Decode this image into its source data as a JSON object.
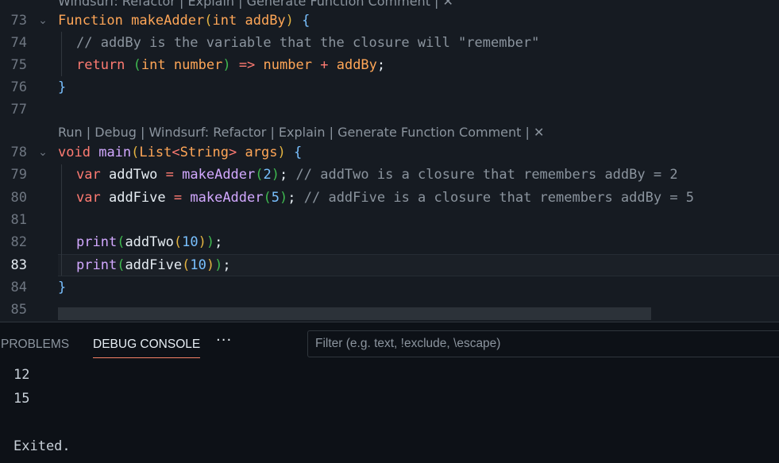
{
  "editor": {
    "codelens_top": {
      "items": [
        "Windsurf: Refactor",
        "Explain",
        "Generate Function Comment"
      ],
      "close": "✕"
    },
    "codelens_main": {
      "items": [
        "Run",
        "Debug",
        "Windsurf: Refactor",
        "Explain",
        "Generate Function Comment"
      ],
      "close": "✕"
    },
    "separator": " | ",
    "lines": [
      {
        "number": "73",
        "tokens": [
          [
            "Function",
            "ty"
          ],
          [
            " ",
            "plain"
          ],
          [
            "makeAdder",
            "id"
          ],
          [
            "(",
            "br3"
          ],
          [
            "int",
            "ty"
          ],
          [
            " ",
            "plain"
          ],
          [
            "addBy",
            "id"
          ],
          [
            ")",
            "br3"
          ],
          [
            " ",
            "plain"
          ],
          [
            "{",
            "br1"
          ]
        ]
      },
      {
        "number": "74",
        "tokens": [
          [
            "// addBy is the variable that the closure will \"remember\"",
            "cm"
          ]
        ]
      },
      {
        "number": "75",
        "tokens": [
          [
            "return",
            "kw"
          ],
          [
            " ",
            "plain"
          ],
          [
            "(",
            "br2"
          ],
          [
            "int",
            "ty"
          ],
          [
            " ",
            "plain"
          ],
          [
            "number",
            "id"
          ],
          [
            ")",
            "br2"
          ],
          [
            " ",
            "plain"
          ],
          [
            "=>",
            "op"
          ],
          [
            " ",
            "plain"
          ],
          [
            "number",
            "id"
          ],
          [
            " ",
            "plain"
          ],
          [
            "+",
            "op"
          ],
          [
            " ",
            "plain"
          ],
          [
            "addBy",
            "id"
          ],
          [
            ";",
            "plain"
          ]
        ]
      },
      {
        "number": "76",
        "tokens": [
          [
            "}",
            "br1"
          ]
        ]
      },
      {
        "number": "77",
        "tokens": []
      },
      {
        "number": "78",
        "tokens": [
          [
            "void",
            "kw"
          ],
          [
            " ",
            "plain"
          ],
          [
            "main",
            "fn"
          ],
          [
            "(",
            "br3"
          ],
          [
            "List",
            "ty"
          ],
          [
            "<",
            "op"
          ],
          [
            "String",
            "ty"
          ],
          [
            ">",
            "op"
          ],
          [
            " ",
            "plain"
          ],
          [
            "args",
            "id"
          ],
          [
            ")",
            "br3"
          ],
          [
            " ",
            "plain"
          ],
          [
            "{",
            "br1"
          ]
        ]
      },
      {
        "number": "79",
        "tokens": [
          [
            "var",
            "kw"
          ],
          [
            " ",
            "plain"
          ],
          [
            "addTwo",
            "plain"
          ],
          [
            " ",
            "plain"
          ],
          [
            "=",
            "op"
          ],
          [
            " ",
            "plain"
          ],
          [
            "makeAdder",
            "fn"
          ],
          [
            "(",
            "br2"
          ],
          [
            "2",
            "num"
          ],
          [
            ")",
            "br2"
          ],
          [
            ";",
            "plain"
          ],
          [
            " ",
            "plain"
          ],
          [
            "// addTwo is a closure that remembers addBy = 2",
            "cm"
          ]
        ]
      },
      {
        "number": "80",
        "tokens": [
          [
            "var",
            "kw"
          ],
          [
            " ",
            "plain"
          ],
          [
            "addFive",
            "plain"
          ],
          [
            " ",
            "plain"
          ],
          [
            "=",
            "op"
          ],
          [
            " ",
            "plain"
          ],
          [
            "makeAdder",
            "fn"
          ],
          [
            "(",
            "br2"
          ],
          [
            "5",
            "num"
          ],
          [
            ")",
            "br2"
          ],
          [
            ";",
            "plain"
          ],
          [
            " ",
            "plain"
          ],
          [
            "// addFive is a closure that remembers addBy = 5",
            "cm"
          ]
        ]
      },
      {
        "number": "81",
        "tokens": []
      },
      {
        "number": "82",
        "tokens": [
          [
            "print",
            "fn"
          ],
          [
            "(",
            "br2"
          ],
          [
            "addTwo",
            "plain"
          ],
          [
            "(",
            "br3"
          ],
          [
            "10",
            "num"
          ],
          [
            ")",
            "br3"
          ],
          [
            ")",
            "br2"
          ],
          [
            ";",
            "plain"
          ]
        ]
      },
      {
        "number": "83",
        "tokens": [
          [
            "print",
            "fn"
          ],
          [
            "(",
            "br2"
          ],
          [
            "addFive",
            "plain"
          ],
          [
            "(",
            "br3"
          ],
          [
            "10",
            "num"
          ],
          [
            ")",
            "br3"
          ],
          [
            ")",
            "br2"
          ],
          [
            ";",
            "plain"
          ]
        ]
      },
      {
        "number": "84",
        "tokens": [
          [
            "}",
            "br1"
          ]
        ]
      },
      {
        "number": "85",
        "tokens": []
      }
    ],
    "current_line": "83"
  },
  "panel": {
    "tabs": [
      "PROBLEMS",
      "DEBUG CONSOLE"
    ],
    "active_tab": "DEBUG CONSOLE",
    "more": "···",
    "filter_placeholder": "Filter (e.g. text, !exclude, \\escape)",
    "filter_value": "",
    "output": [
      "12",
      "15",
      "",
      "Exited."
    ]
  },
  "colors": {
    "editor_bg": "#161b22",
    "panel_bg": "#0d1117",
    "keyword": "#ff7b72",
    "type": "#ffa657",
    "function": "#d2a8ff",
    "comment": "#8b949e",
    "number": "#79c0ff",
    "active_tab_underline": "#f78166"
  }
}
